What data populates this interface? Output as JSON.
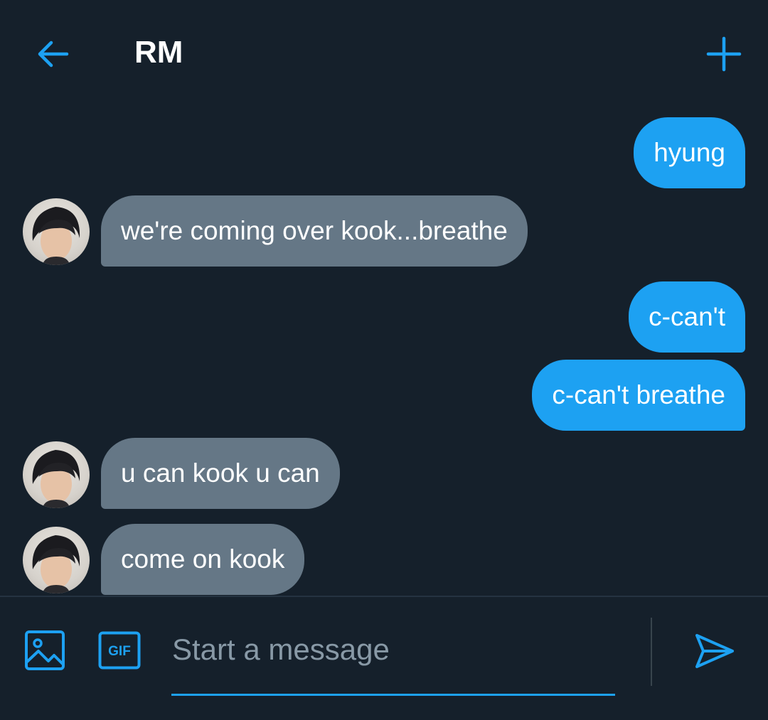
{
  "header": {
    "back_icon": "arrow-left-icon",
    "title": "RM",
    "plus_icon": "plus-icon",
    "accent_color": "#1da1f2"
  },
  "messages": [
    {
      "side": "sent",
      "text": "hyung"
    },
    {
      "side": "received",
      "text": "we're coming over kook...breathe"
    },
    {
      "side": "sent",
      "text": "c-can't"
    },
    {
      "side": "sent",
      "text": "c-can't breathe"
    },
    {
      "side": "received",
      "text": "u can kook u can"
    },
    {
      "side": "received",
      "text": "come on kook"
    }
  ],
  "composer": {
    "media_icon": "image-icon",
    "gif_label": "GIF",
    "placeholder": "Start a message",
    "value": "",
    "send_icon": "send-icon"
  },
  "colors": {
    "background": "#15202b",
    "sent_bubble": "#1da1f2",
    "received_bubble": "#657786",
    "placeholder": "#8899a6"
  }
}
